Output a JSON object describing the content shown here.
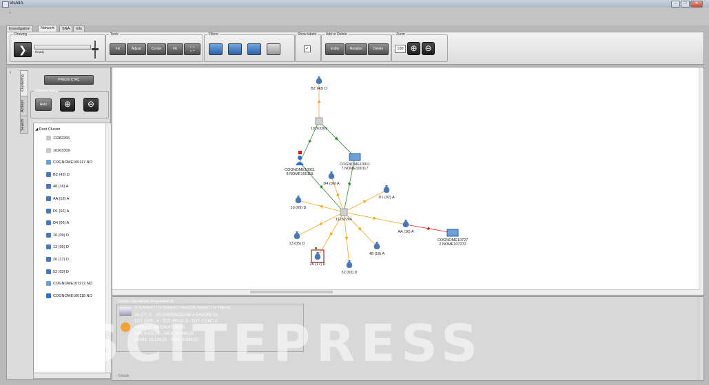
{
  "window": {
    "title": "VisAIIA"
  },
  "tabs": [
    {
      "label": "Investigation"
    },
    {
      "label": "Network"
    },
    {
      "label": "SNA"
    },
    {
      "label": "Info"
    }
  ],
  "ribbon": {
    "drawing": {
      "label": "Drawing",
      "status": "Ready"
    },
    "tools": {
      "label": "Tools",
      "buttons": [
        "Fix",
        "Adjust",
        "Center",
        "Fit"
      ]
    },
    "filters": {
      "label": "Filters"
    },
    "show_labels": {
      "label": "Show labels",
      "checked": true
    },
    "add_delete": {
      "label": "Add or Delete",
      "buttons": [
        "Entity",
        "Relation",
        "Delete"
      ]
    },
    "zoom": {
      "label": "Zoom",
      "value": "100"
    }
  },
  "left_panel": {
    "vtabs": [
      "Clustering",
      "Actions",
      "Search"
    ],
    "press_ctrl": "PRESS CTRL",
    "clusters_menu_label": "Clusters menu",
    "auto_button": "Auto",
    "clusters_tree_label": "Clusters tree",
    "tree_root": "Root Cluster",
    "tree_items": [
      {
        "label": "11282266",
        "icon": "account-icon"
      },
      {
        "label": "10263309",
        "icon": "account-icon"
      },
      {
        "label": "COGNOME100117 NO",
        "icon": "company-icon"
      },
      {
        "label": "BZ (43) D",
        "icon": "money-bag-icon"
      },
      {
        "label": "48 (16) A",
        "icon": "money-bag-icon"
      },
      {
        "label": "AA (16) A",
        "icon": "money-bag-icon"
      },
      {
        "label": "D1 (02) A",
        "icon": "money-bag-icon"
      },
      {
        "label": "D4 (06) A",
        "icon": "money-bag-icon"
      },
      {
        "label": "10 (09) D",
        "icon": "money-bag-icon"
      },
      {
        "label": "13 (05) D",
        "icon": "money-bag-icon"
      },
      {
        "label": "26 (17) D",
        "icon": "money-bag-icon"
      },
      {
        "label": "52 (03) D",
        "icon": "money-bag-icon"
      },
      {
        "label": "COGNOME107272 NO",
        "icon": "company-icon"
      },
      {
        "label": "COGNOME100118 NO",
        "icon": "person-icon"
      }
    ]
  },
  "graph": {
    "nodes": [
      {
        "label": "BZ (43) D",
        "type": "bag"
      },
      {
        "label": "10263309",
        "type": "account"
      },
      {
        "label": "COGNOME10011\n8 NOME100118",
        "type": "person"
      },
      {
        "label": "COGNOME10011\n7 NOME100117",
        "type": "company"
      },
      {
        "label": "D4 (06) A",
        "type": "bag"
      },
      {
        "label": "D1 (02) A",
        "type": "bag"
      },
      {
        "label": "10 (09) D",
        "type": "bag"
      },
      {
        "label": "11282266",
        "type": "account"
      },
      {
        "label": "AA (16) A",
        "type": "bag"
      },
      {
        "label": "COGNOME10727\n2 NOME107272",
        "type": "company"
      },
      {
        "label": "13 (05) D",
        "type": "bag"
      },
      {
        "label": "26 (17) D",
        "type": "bag",
        "selected": true
      },
      {
        "label": "48 (16) A",
        "type": "bag"
      },
      {
        "label": "52 (03) D",
        "type": "bag"
      }
    ]
  },
  "details": {
    "title": "Details Operativita (Acquisition 4)",
    "checks": [
      {
        "label": "Is Active",
        "checked": true
      },
      {
        "label": "Is Deleted",
        "checked": false
      },
      {
        "label": "Manually Added",
        "checked": false
      },
      {
        "label": "Is Filtered",
        "checked": false
      }
    ],
    "line1": "26 (17) D - VS DISPOSIZIONE A FAVORE DI",
    "line2": "TOT. OPE.: 4 - TOT. FRAZ: 3 - TOT. CONT: 0",
    "line3": "AMOUNT: 64.536,47 (EUR)",
    "line4": "MIN: 8.000,00 - MAX: 32.446,00",
    "line5": "MEAN: 16.134,12 - SQM: 9.648,32",
    "footer": "Details"
  },
  "watermark": "SCITEPRESS",
  "colors": {
    "edge_orange": "#f5a623",
    "edge_green": "#2e8b2e",
    "edge_red": "#e02020",
    "bag_blue": "#4a77b8",
    "selected_border": "#b22222"
  }
}
